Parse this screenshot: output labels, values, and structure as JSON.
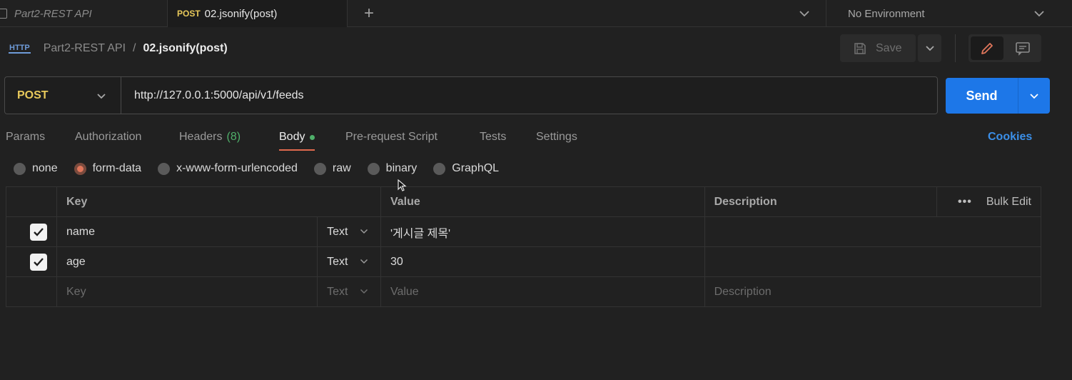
{
  "tabs": {
    "inactive_label": "Part2-REST API",
    "active_method": "POST",
    "active_label": "02.jsonify(post)",
    "environment": "No Environment"
  },
  "breadcrumb": {
    "icon_text": "HTTP",
    "collection": "Part2-REST API",
    "separator": "/",
    "request": "02.jsonify(post)"
  },
  "toolbar": {
    "save_label": "Save"
  },
  "request": {
    "method": "POST",
    "url": "http://127.0.0.1:5000/api/v1/feeds",
    "send_label": "Send"
  },
  "request_tabs": {
    "params": "Params",
    "authorization": "Authorization",
    "headers": "Headers",
    "headers_count": "(8)",
    "body": "Body",
    "prerequest": "Pre-request Script",
    "tests": "Tests",
    "settings": "Settings",
    "cookies": "Cookies"
  },
  "body_types": {
    "none": "none",
    "form_data": "form-data",
    "urlencoded": "x-www-form-urlencoded",
    "raw": "raw",
    "binary": "binary",
    "graphql": "GraphQL",
    "selected": "form-data"
  },
  "table": {
    "headers": {
      "key": "Key",
      "value": "Value",
      "description": "Description",
      "bulk_edit": "Bulk Edit"
    },
    "rows": [
      {
        "key": "name",
        "type": "Text",
        "value": "'게시글 제목'",
        "checked": true
      },
      {
        "key": "age",
        "type": "Text",
        "value": "30",
        "checked": true
      }
    ],
    "placeholder": {
      "key": "Key",
      "type": "Text",
      "value": "Value",
      "description": "Description"
    }
  },
  "colors": {
    "accent_blue": "#1d77e8",
    "method_yellow": "#e8c95b",
    "active_tab_underline": "#e06a4e",
    "indicator_green": "#4fb06a"
  }
}
